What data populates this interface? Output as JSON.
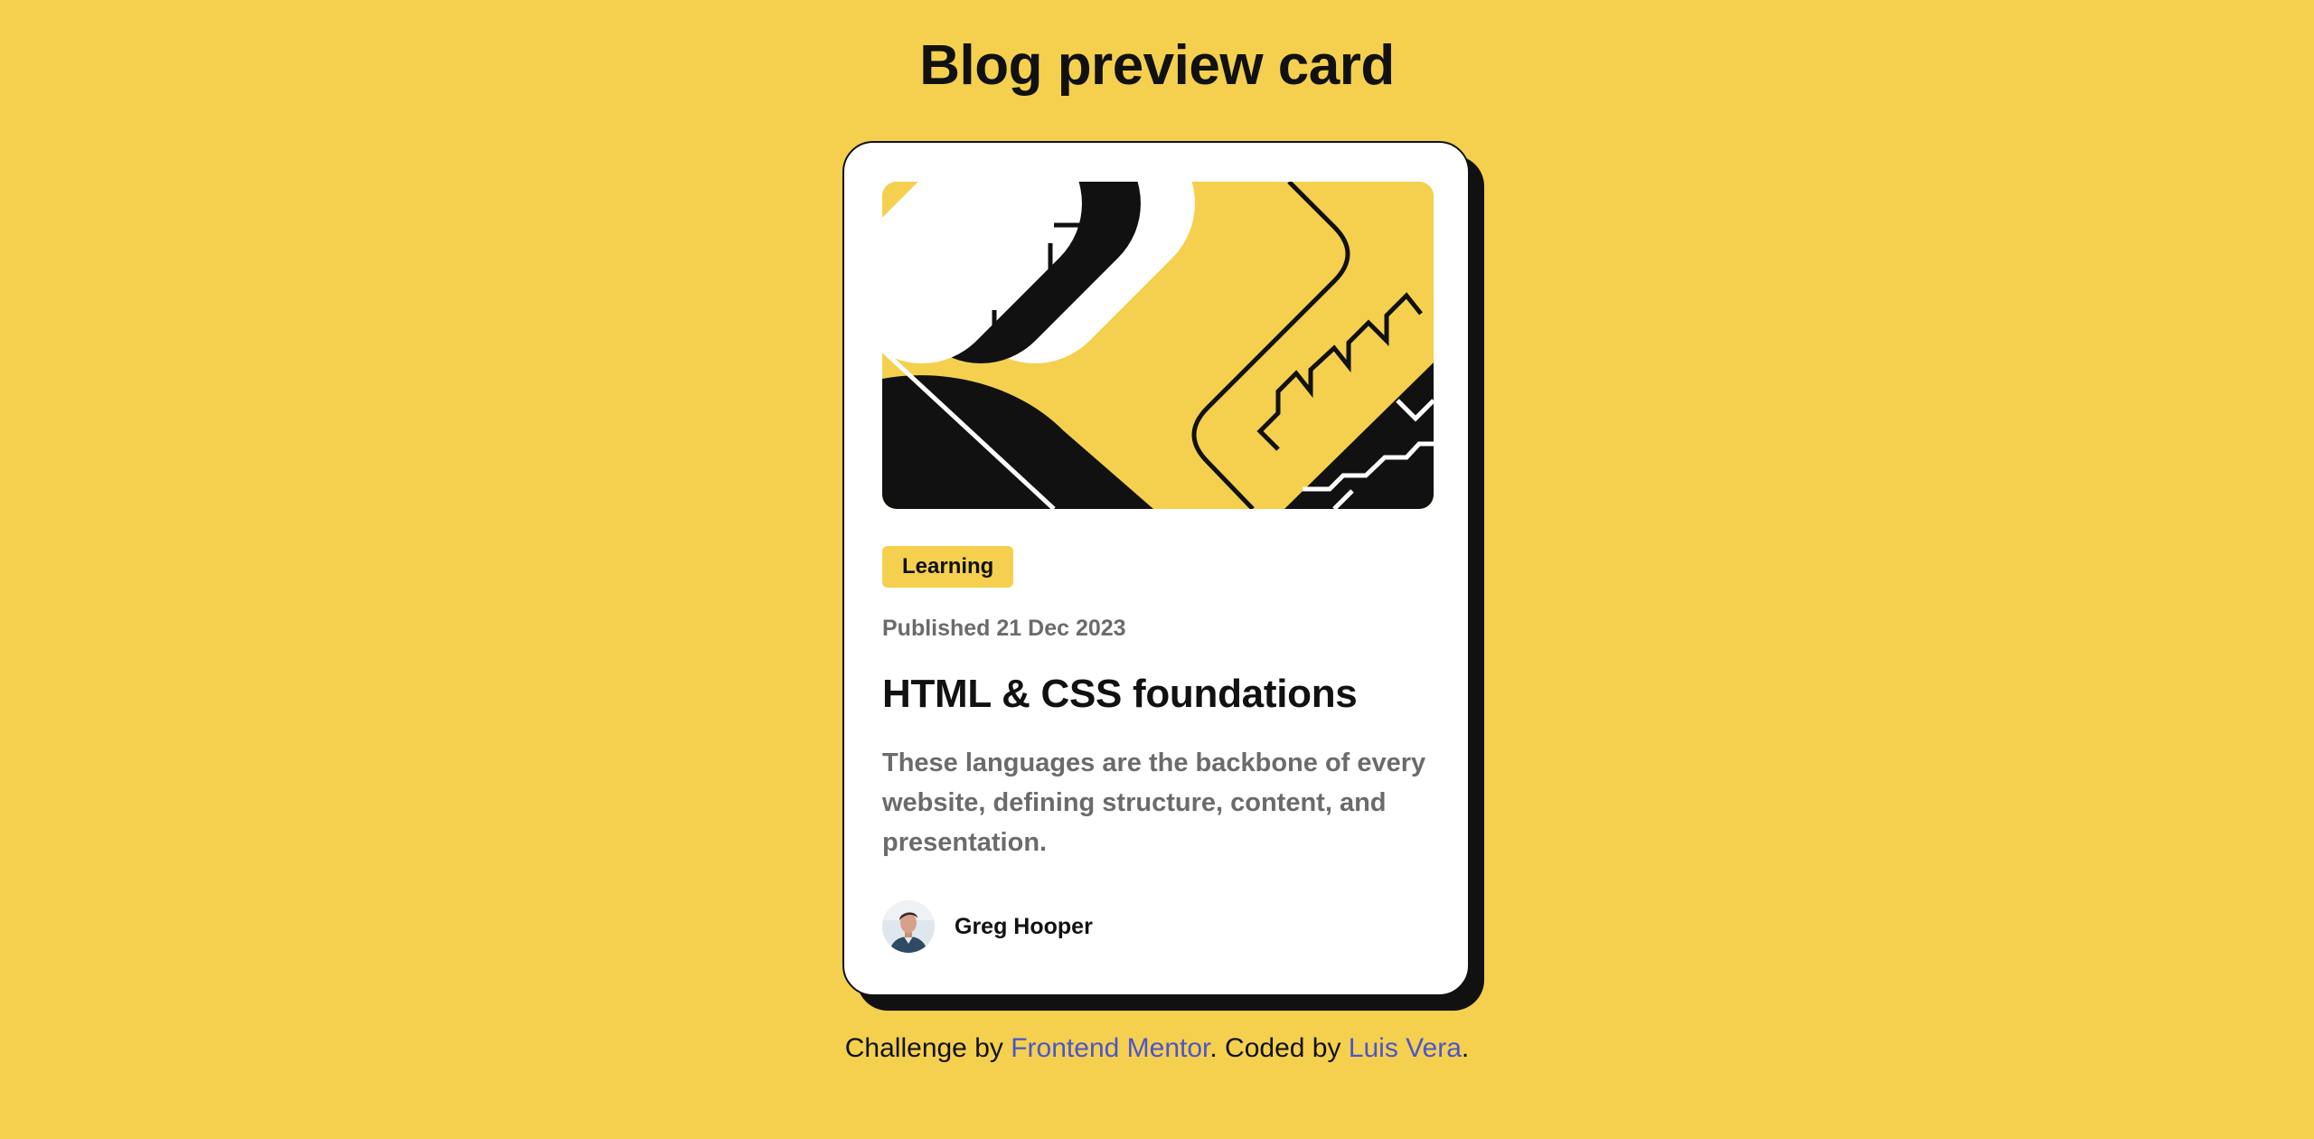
{
  "page": {
    "title": "Blog preview card"
  },
  "card": {
    "tag": "Learning",
    "published": "Published 21 Dec 2023",
    "title": "HTML & CSS foundations",
    "description": "These languages are the backbone of every website, defining structure, content, and presentation.",
    "author": {
      "name": "Greg Hooper"
    }
  },
  "attribution": {
    "prefix": "Challenge by",
    "mentor_link": "Frontend Mentor",
    "middle": ". Coded by",
    "author_link": "Luis Vera",
    "suffix": "."
  },
  "colors": {
    "background": "#F4D04E",
    "card": "#FFFFFF",
    "ink": "#111111",
    "muted_text": "#6B6B6B",
    "link": "#4B55CC"
  },
  "icons": {
    "hero": "abstract-illustration-icon",
    "avatar": "author-avatar-icon"
  }
}
